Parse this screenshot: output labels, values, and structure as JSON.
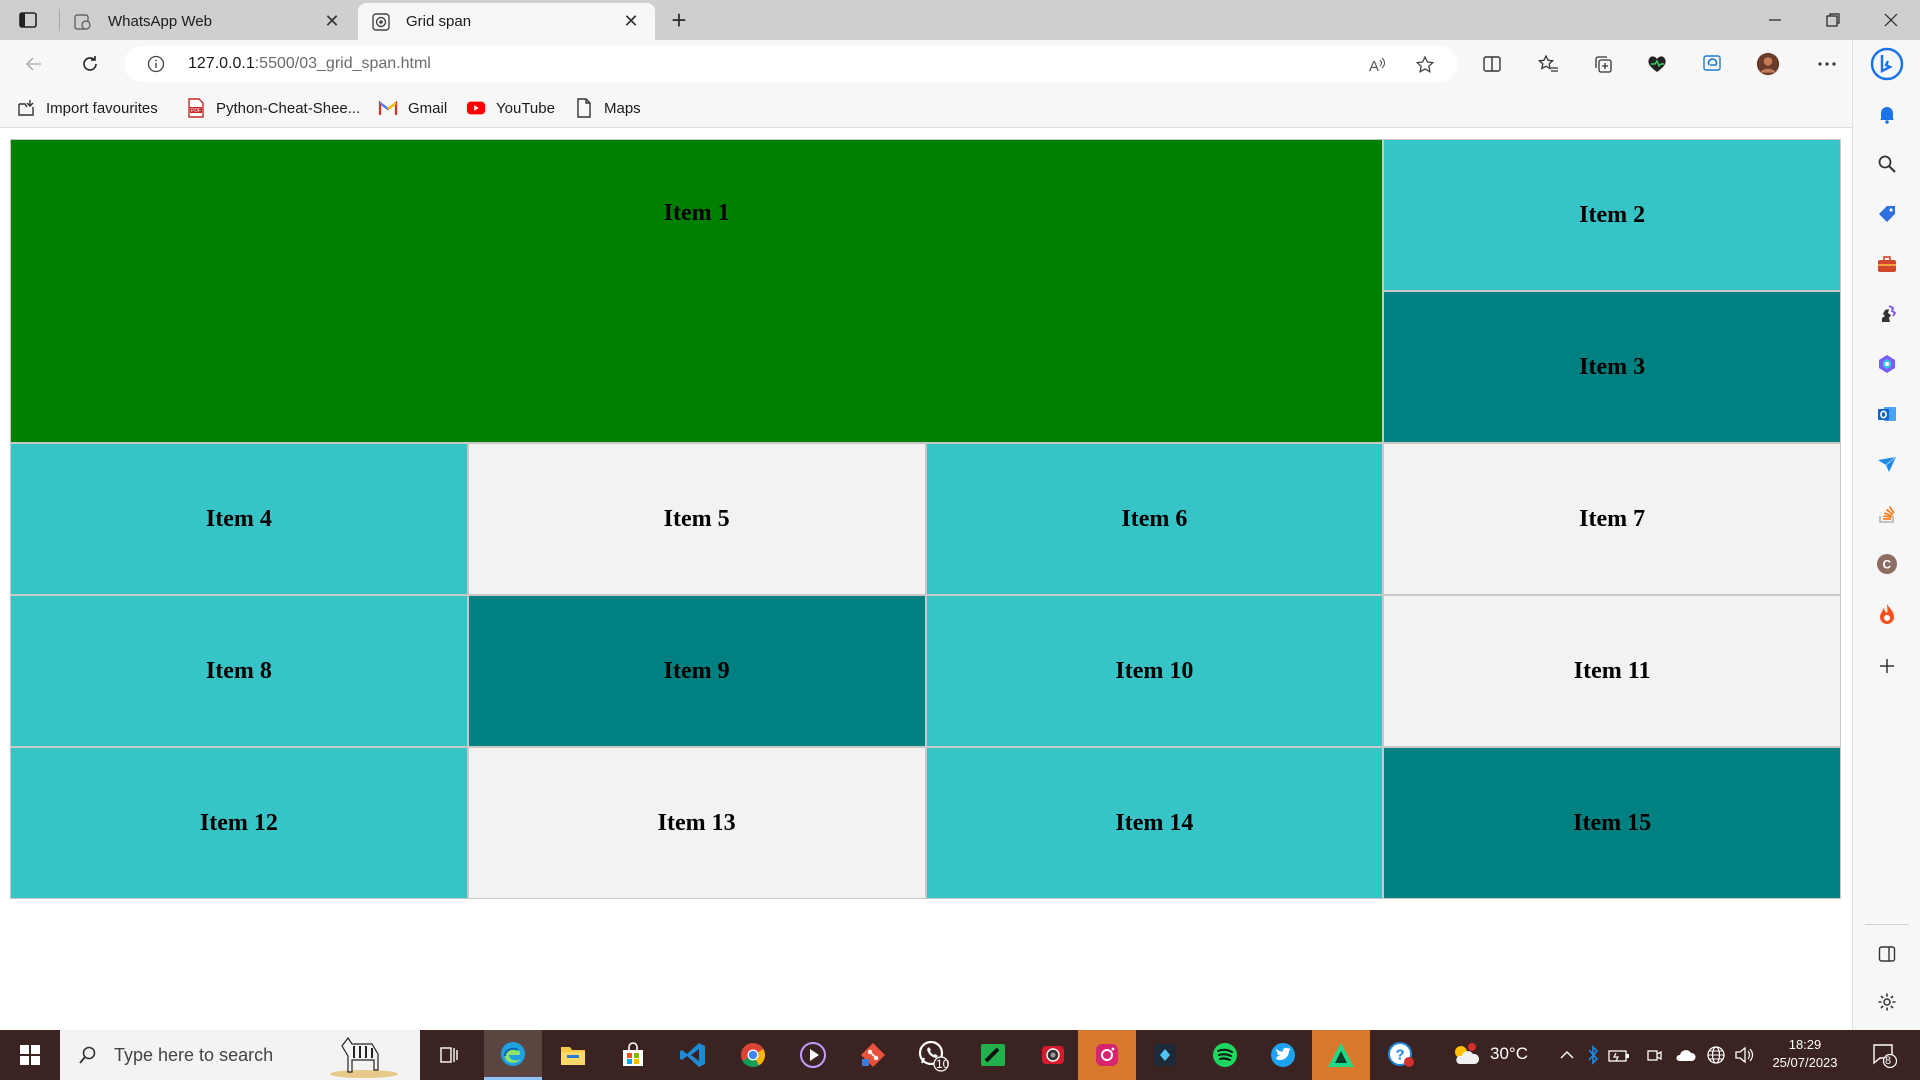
{
  "browser": {
    "tabs": [
      {
        "title": "WhatsApp Web",
        "active": false
      },
      {
        "title": "Grid span",
        "active": true
      }
    ],
    "address": {
      "host": "127.0.0.1",
      "path": ":5500/03_grid_span.html"
    },
    "favourites": [
      {
        "label": "Import favourites",
        "icon": "import-icon"
      },
      {
        "label": "Python-Cheat-Shee...",
        "icon": "pdf-icon"
      },
      {
        "label": "Gmail",
        "icon": "gmail-icon"
      },
      {
        "label": "YouTube",
        "icon": "youtube-icon"
      },
      {
        "label": "Maps",
        "icon": "page-icon"
      }
    ]
  },
  "page": {
    "items": [
      {
        "label": "Item 1",
        "color": "#008000"
      },
      {
        "label": "Item 2",
        "color": "#37c4c6"
      },
      {
        "label": "Item 3",
        "color": "#008080"
      },
      {
        "label": "Item 4",
        "color": "#37c4c6"
      },
      {
        "label": "Item 5",
        "color": "#f2f2f2"
      },
      {
        "label": "Item 6",
        "color": "#37c4c6"
      },
      {
        "label": "Item 7",
        "color": "#f2f2f2"
      },
      {
        "label": "Item 8",
        "color": "#37c4c6"
      },
      {
        "label": "Item 9",
        "color": "#008080"
      },
      {
        "label": "Item 10",
        "color": "#37c4c6"
      },
      {
        "label": "Item 11",
        "color": "#f2f2f2"
      },
      {
        "label": "Item 12",
        "color": "#37c4c6"
      },
      {
        "label": "Item 13",
        "color": "#f2f2f2"
      },
      {
        "label": "Item 14",
        "color": "#37c4c6"
      },
      {
        "label": "Item 15",
        "color": "#008080"
      }
    ]
  },
  "taskbar": {
    "search_placeholder": "Type here to search",
    "whatsapp_badge": "10",
    "weather": "30°C",
    "time": "18:29",
    "date": "25/07/2023",
    "notification_count": "8"
  }
}
